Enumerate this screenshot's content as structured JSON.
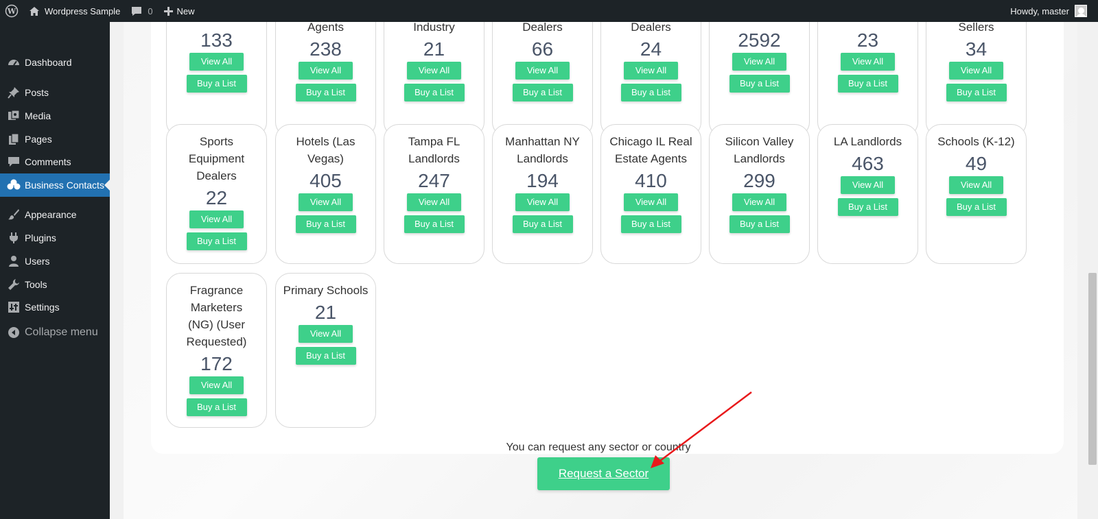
{
  "admin_bar": {
    "site_name": "Wordpress Sample",
    "comments_count": "0",
    "new_label": "New",
    "greeting": "Howdy, master"
  },
  "sidebar": {
    "items": [
      {
        "label": "Dashboard",
        "icon": "dashboard-icon"
      },
      {
        "label": "Posts",
        "icon": "pin-icon"
      },
      {
        "label": "Media",
        "icon": "media-icon"
      },
      {
        "label": "Pages",
        "icon": "pages-icon"
      },
      {
        "label": "Comments",
        "icon": "comments-icon"
      },
      {
        "label": "Business Contacts",
        "icon": "groups-icon",
        "active": true
      },
      {
        "label": "Appearance",
        "icon": "brush-icon"
      },
      {
        "label": "Plugins",
        "icon": "plugin-icon"
      },
      {
        "label": "Users",
        "icon": "user-icon"
      },
      {
        "label": "Tools",
        "icon": "wrench-icon"
      },
      {
        "label": "Settings",
        "icon": "settings-icon"
      },
      {
        "label": "Collapse menu",
        "icon": "collapse-icon"
      }
    ]
  },
  "cards": {
    "view_label": "View All",
    "buy_label": "Buy a List",
    "row1": [
      {
        "name": "",
        "count": "133"
      },
      {
        "name": "Agents",
        "count": "238"
      },
      {
        "name": "Industry",
        "count": "21"
      },
      {
        "name": "Dealers",
        "count": "66"
      },
      {
        "name": "Dealers",
        "count": "24"
      },
      {
        "name": "",
        "count": "2592"
      },
      {
        "name": "",
        "count": "23"
      },
      {
        "name": "Sellers",
        "count": "34"
      }
    ],
    "row2": [
      {
        "name": "Sports Equipment Dealers",
        "count": "22"
      },
      {
        "name": "Hotels (Las Vegas)",
        "count": "405"
      },
      {
        "name": "Tampa FL Landlords",
        "count": "247"
      },
      {
        "name": "Manhattan NY Landlords",
        "count": "194"
      },
      {
        "name": "Chicago IL Real Estate Agents",
        "count": "410"
      },
      {
        "name": "Silicon Valley Landlords",
        "count": "299"
      },
      {
        "name": "LA Landlords",
        "count": "463"
      },
      {
        "name": "Schools (K-12)",
        "count": "49"
      }
    ],
    "row3": [
      {
        "name": "Fragrance Marketers (NG) (User Requested)",
        "count": "172"
      },
      {
        "name": "Primary Schools",
        "count": "21"
      }
    ]
  },
  "request": {
    "text": "You can request any sector or country",
    "button_label": "Request a Sector"
  },
  "colors": {
    "accent_green": "#3ed08a",
    "admin_dark": "#1d2327",
    "active_blue": "#2271b1",
    "annotation_red": "#e8191b"
  }
}
